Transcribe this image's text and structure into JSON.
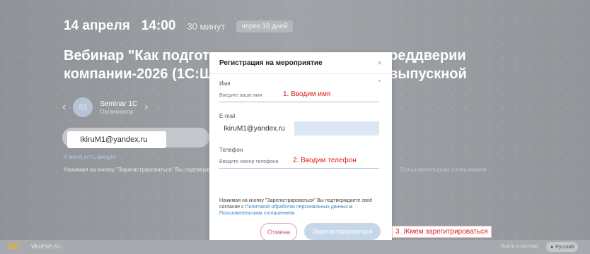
{
  "event": {
    "date": "14 апреля",
    "time": "14:00",
    "duration": "30 минут",
    "badge": "через 18 дней",
    "title_part1": "Вебинар \"Как подготови",
    "title_part2": "компании-2026 (1С:Шко",
    "title_part3": "реддверии выпускной"
  },
  "organizer": {
    "avatar": "S1",
    "name": "Seminar 1C",
    "role": "Организатор"
  },
  "background_email": "IkiruM1@yandex.ru",
  "background_link": "У меня есть аккаунт",
  "background_consent_left": "Нажимая на кнопку \"Зарегистрироваться\" Вы подтвержд",
  "background_consent_right": "Пользовательским соглашением",
  "modal": {
    "title": "Регистрация на мероприятие",
    "close": "×",
    "name_label": "Имя",
    "required_mark": "*",
    "name_placeholder": "Введите ваше имя",
    "email_label": "E-mail",
    "email_value": "IkiruM1@yandex.ru",
    "phone_label": "Телефон",
    "phone_placeholder": "Введите номер телефона",
    "consent_text": "Нажимая на кнопку \"Зарегистрироваться\" Вы подтверждаете своё согласие с",
    "consent_link1": "Политикой обработки персональных данных",
    "consent_and": "и",
    "consent_link2": "Пользовательским соглашением",
    "cancel": "Отмена",
    "register": "Зарегистрироваться"
  },
  "annotations": {
    "step1": "1. Вводим имя",
    "step2": "2. Вводим телефон",
    "step3": "3. Жмем зарегитрироваться"
  },
  "footer": {
    "logo": "1С",
    "site": "vkurse.ru",
    "login": "Войти в систему",
    "lang": "Русский"
  }
}
